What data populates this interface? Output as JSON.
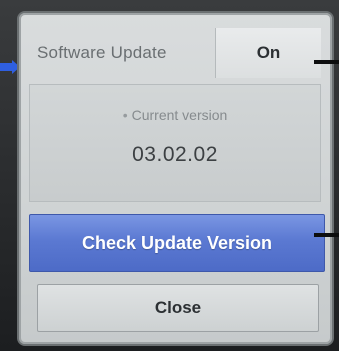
{
  "software_update": {
    "label": "Software Update",
    "value": "On"
  },
  "current_version": {
    "label": "Current version",
    "value": "03.02.02"
  },
  "buttons": {
    "check_update": "Check Update Version",
    "close": "Close"
  },
  "colors": {
    "dialog_bg": "#d4d8d9",
    "primary_button": "#5b79d2",
    "pointer": "#0d0e0f",
    "arrow": "#2f5fe0"
  }
}
